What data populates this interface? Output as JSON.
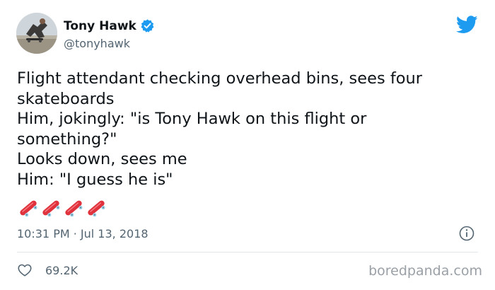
{
  "author": {
    "display_name": "Tony Hawk",
    "handle": "@tonyhawk"
  },
  "tweet": {
    "lines": [
      "Flight attendant checking overhead bins, sees four",
      "skateboards",
      "Him, jokingly: \"is Tony Hawk on this flight or",
      "something?\"",
      "Looks down, sees me",
      "Him: \"I guess he is\""
    ],
    "emoji": [
      "skateboard-emoji",
      "skateboard-emoji",
      "skateboard-emoji",
      "skateboard-emoji"
    ],
    "timestamp": "10:31 PM · Jul 13, 2018"
  },
  "engagement": {
    "likes": "69.2K"
  },
  "watermark": "boredpanda.com",
  "icons": {
    "verified": "verified-badge-icon",
    "brand": "twitter-bird-icon",
    "info": "info-icon",
    "like": "heart-icon"
  },
  "colors": {
    "twitter_blue": "#1d9bf0",
    "secondary_text": "#536471",
    "skateboard_red": "#e0323c"
  }
}
